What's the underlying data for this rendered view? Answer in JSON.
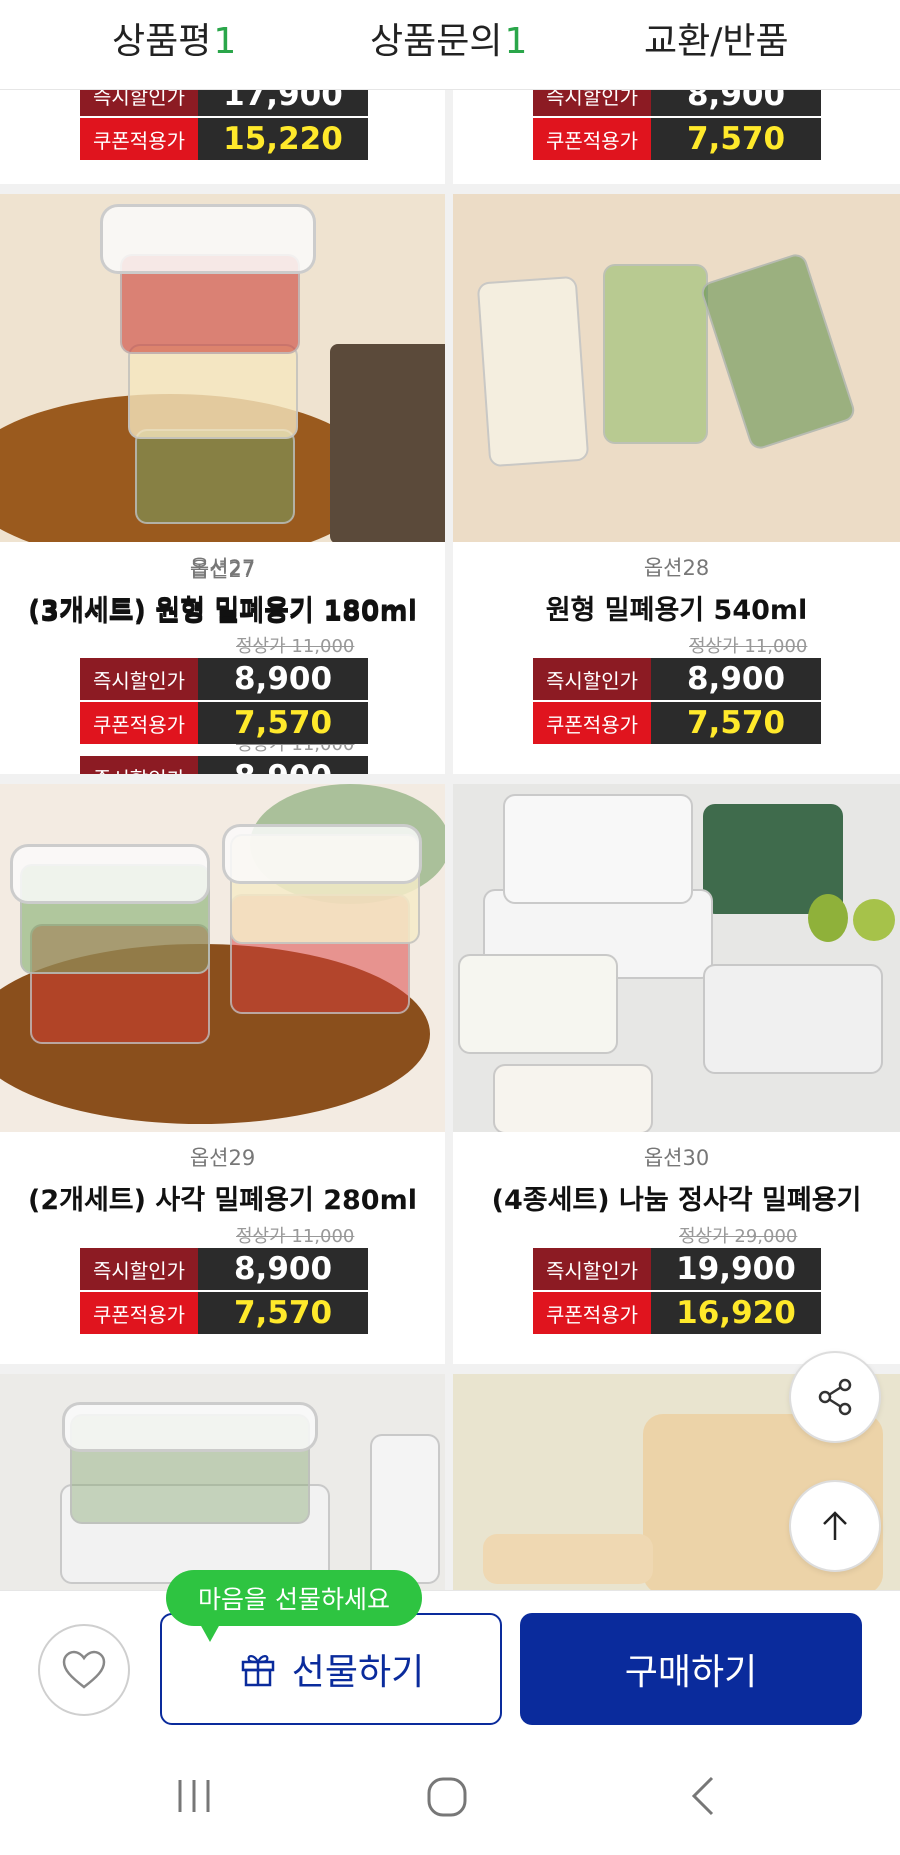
{
  "tabs": [
    {
      "label": "상품평",
      "count": "1"
    },
    {
      "label": "상품문의",
      "count": "1"
    },
    {
      "label": "교환/반품",
      "count": ""
    }
  ],
  "labels": {
    "instant": "즉시할인가",
    "coupon": "쿠폰적용가",
    "original_prefix": "정상가"
  },
  "products_top": [
    {
      "instant": "17,900",
      "coupon": "15,220"
    },
    {
      "instant": "8,900",
      "coupon": "7,570"
    }
  ],
  "products": [
    {
      "option": "옵션27",
      "name": "(3개세트) 원형 밀폐용기 180ml",
      "original": "정상가 11,000",
      "instant": "8,900",
      "coupon": "7,570"
    },
    {
      "option": "옵션28",
      "name": "원형 밀폐용기 540ml",
      "original": "정상가 11,000",
      "instant": "8,900",
      "coupon": "7,570"
    },
    {
      "option": "옵션29",
      "name": "(2개세트) 사각 밀폐용기 280ml",
      "original": "정상가 11,000",
      "instant": "8,900",
      "coupon": "7,570"
    },
    {
      "option": "옵션30",
      "name": "(4종세트) 나눔 정사각 밀폐용기",
      "original": "정상가 29,000",
      "instant": "19,900",
      "coupon": "16,920"
    }
  ],
  "actions": {
    "gift_tooltip": "마음을 선물하세요",
    "gift": "선물하기",
    "buy": "구매하기"
  },
  "colors": {
    "accent_blue": "#0a2b9c",
    "instant_label": "#8c1b23",
    "coupon_label": "#e0141e",
    "coupon_value": "#ffe92b",
    "count_green": "#2aa64a",
    "tooltip_green": "#2ec441"
  },
  "icons": [
    "share-icon",
    "arrow-up-icon",
    "heart-icon",
    "gift-icon",
    "recents-icon",
    "home-icon",
    "back-icon"
  ]
}
